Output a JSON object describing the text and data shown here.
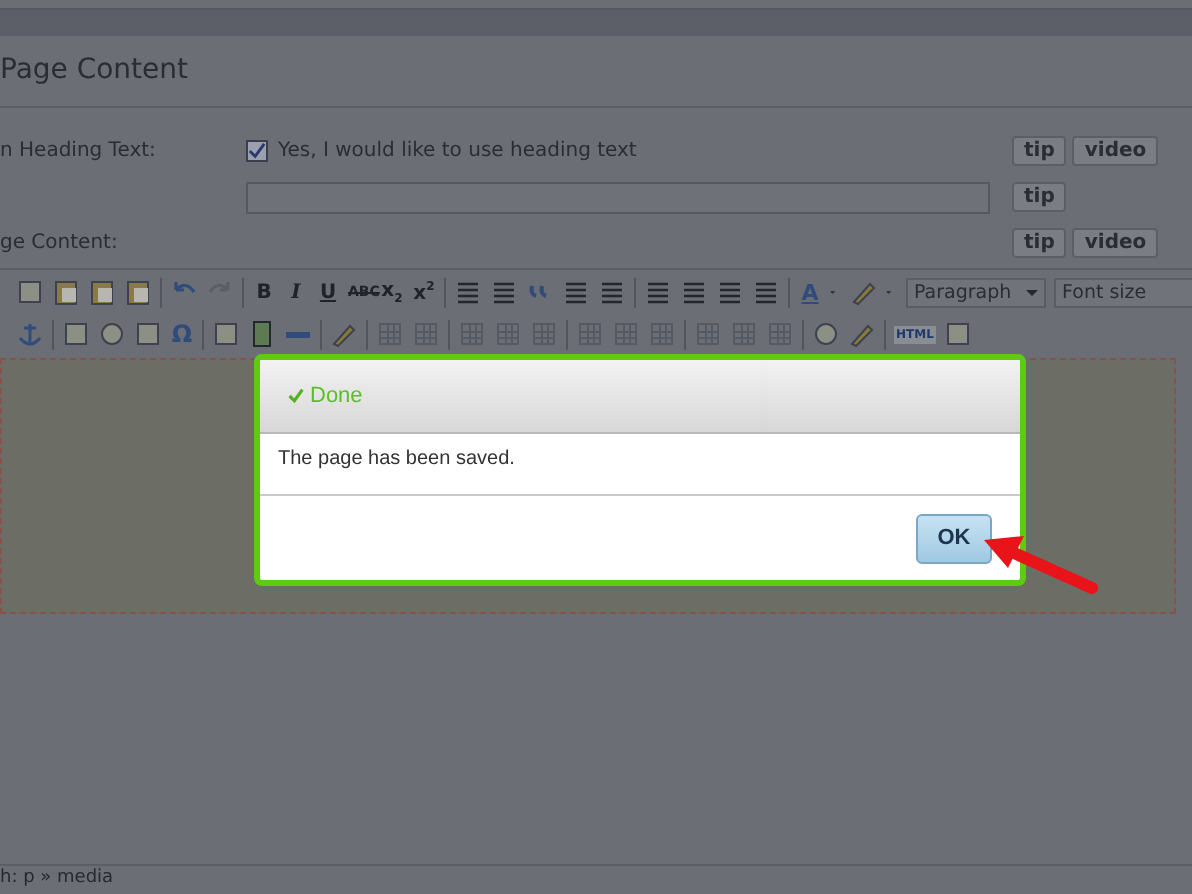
{
  "page_title": "Page Content",
  "fields": [
    {
      "kind": "checkbox",
      "label": "n Heading Text:",
      "option": "Yes, I would like to use heading text",
      "checked": true,
      "buttons": [
        "tip",
        "video"
      ]
    },
    {
      "kind": "text",
      "buttons": [
        "tip"
      ]
    },
    {
      "kind": "editor",
      "label": "ge Content:",
      "buttons": [
        "tip",
        "video"
      ]
    }
  ],
  "toolbar_texts": [
    "B",
    "I",
    "U",
    "ABC",
    "x$_{2}$",
    "x$^{2}$",
    "A",
    "Ω",
    "HTML"
  ],
  "selects": [
    "Paragraph",
    "Font size"
  ],
  "status_bar": "h: p » media",
  "dialog": {
    "title": "Done",
    "message": "The page has been saved.",
    "button": "OK"
  }
}
